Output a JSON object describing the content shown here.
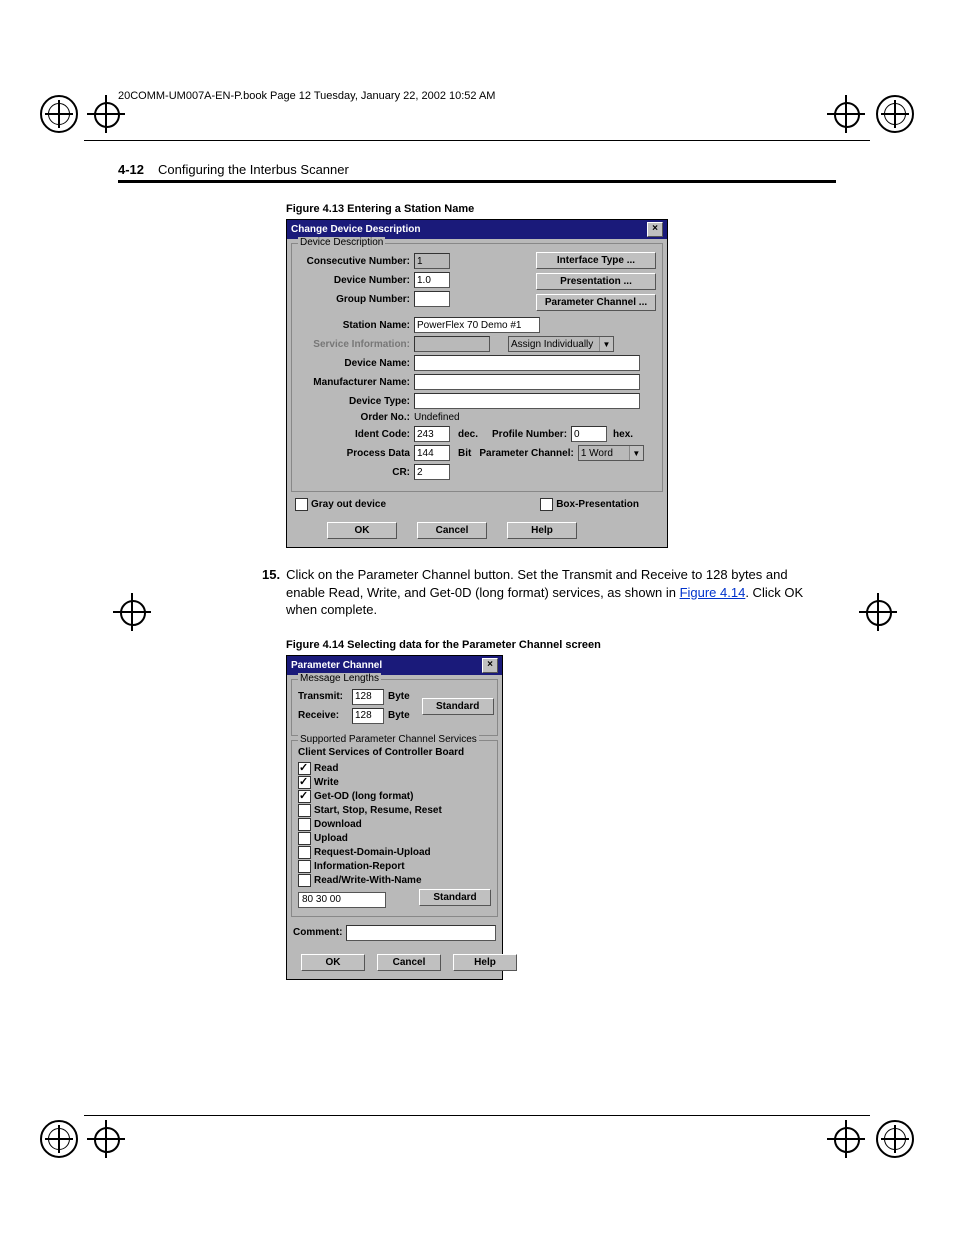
{
  "book_header": "20COMM-UM007A-EN-P.book  Page 12  Tuesday, January 22, 2002  10:52 AM",
  "section": {
    "num": "4-12",
    "title": "Configuring the Interbus Scanner"
  },
  "fig413_caption": "Figure 4.13   Entering a Station Name",
  "dlg1": {
    "title": "Change Device Description",
    "group": "Device Description",
    "consecutive_lbl": "Consecutive Number:",
    "consecutive_val": "1",
    "devnum_lbl": "Device Number:",
    "devnum_val": "1.0",
    "grpnum_lbl": "Group Number:",
    "grpnum_val": "",
    "station_lbl": "Station Name:",
    "station_val": "PowerFlex 70 Demo #1",
    "service_lbl": "Service Information:",
    "service_opt": "Assign Individually",
    "devname_lbl": "Device Name:",
    "mfr_lbl": "Manufacturer Name:",
    "devtype_lbl": "Device Type:",
    "orderno_lbl": "Order No.:",
    "orderno_val": "Undefined",
    "ident_lbl": "Ident Code:",
    "ident_val": "243",
    "ident_unit": "dec.",
    "profile_lbl": "Profile Number:",
    "profile_val": "0",
    "profile_unit": "hex.",
    "pdata_lbl": "Process Data",
    "pdata_val": "144",
    "pdata_unit": "Bit",
    "pchan_lbl": "Parameter Channel:",
    "pchan_opt": "1 Word",
    "cr_lbl": "CR:",
    "cr_val": "2",
    "btn_interface": "Interface Type ...",
    "btn_presentation": "Presentation ...",
    "btn_paramchan": "Parameter Channel ...",
    "gray_out": "Gray out device",
    "box_pres": "Box-Presentation",
    "ok": "OK",
    "cancel": "Cancel",
    "help": "Help"
  },
  "step15": {
    "num": "15.",
    "text_a": "Click on the Parameter Channel button. Set the Transmit and Receive to 128 bytes and enable Read, Write, and Get-0D (long format) services, as shown in ",
    "link": "Figure 4.14",
    "text_b": ". Click OK when complete."
  },
  "fig414_caption": "Figure 4.14   Selecting data for the Parameter Channel screen",
  "dlg2": {
    "title": "Parameter Channel",
    "group_msg": "Message Lengths",
    "transmit_lbl": "Transmit:",
    "transmit_val": "128",
    "byte": "Byte",
    "receive_lbl": "Receive:",
    "receive_val": "128",
    "standard": "Standard",
    "group_svc": "Supported Parameter Channel Services",
    "client_hdr": "Client Services of Controller Board",
    "svc_read": "Read",
    "svc_write": "Write",
    "svc_getod": "Get-OD (long format)",
    "svc_ssrr": "Start, Stop, Resume, Reset",
    "svc_dl": "Download",
    "svc_ul": "Upload",
    "svc_rdu": "Request-Domain-Upload",
    "svc_ir": "Information-Report",
    "svc_rwwn": "Read/Write-With-Name",
    "code": "80 30 00",
    "comment_lbl": "Comment:",
    "ok": "OK",
    "cancel": "Cancel",
    "help": "Help"
  }
}
